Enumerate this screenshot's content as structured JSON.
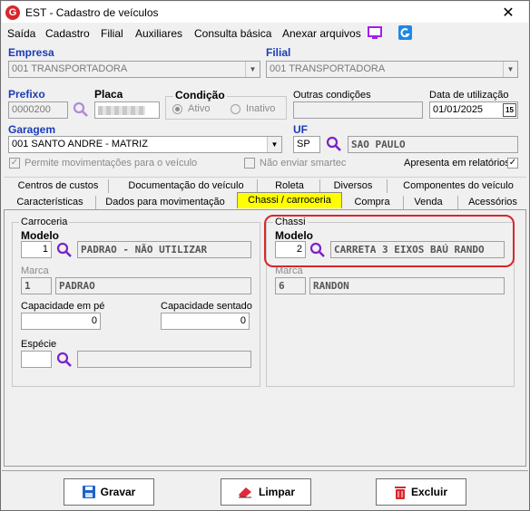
{
  "window": {
    "title": "EST - Cadastro de veículos",
    "close": "✕"
  },
  "menu": [
    "Saída",
    "Cadastro",
    "Filial",
    "Auxiliares",
    "Consulta básica",
    "Anexar arquivos"
  ],
  "header": {
    "empresa_label": "Empresa",
    "empresa_value": "001 TRANSPORTADORA",
    "filial_label": "Filial",
    "filial_value": "001 TRANSPORTADORA",
    "prefixo_label": "Prefixo",
    "prefixo_value": "0000200",
    "placa_label": "Placa",
    "condicao_label": "Condição",
    "ativo_label": "Ativo",
    "inativo_label": "Inativo",
    "outras_label": "Outras condições",
    "data_label": "Data de utilização",
    "data_value": "01/01/2025",
    "cal_label": "15",
    "garagem_label": "Garagem",
    "garagem_value": "001 SANTO ANDRE - MATRIZ",
    "uf_label": "UF",
    "uf_value": "SP",
    "uf_name": "SAO PAULO",
    "permite_label": "Permite movimentações para o veículo",
    "smartec_label": "Não enviar smartec",
    "relatorios_label": "Apresenta em relatórios",
    "check_mark": "✓"
  },
  "tabs_row1": [
    "Centros de custos",
    "Documentação do veículo",
    "Roleta",
    "Diversos",
    "Componentes do veículo"
  ],
  "tabs_row2": [
    "Características",
    "Dados para movimentação",
    "Chassi / carroceria",
    "Compra",
    "Venda",
    "Acessórios"
  ],
  "carroceria": {
    "group_title": "Carroceria",
    "modelo_label": "Modelo",
    "modelo_code": "1",
    "modelo_name": "PADRAO - NÃO UTILIZAR",
    "marca_label": "Marca",
    "marca_code": "1",
    "marca_name": "PADRAO",
    "cap_pe_label": "Capacidade em pé",
    "cap_pe_value": "0",
    "cap_sentado_label": "Capacidade sentado",
    "cap_sentado_value": "0",
    "especie_label": "Espécie"
  },
  "chassi": {
    "group_title": "Chassi",
    "modelo_label": "Modelo",
    "modelo_code": "2",
    "modelo_name": "CARRETA 3 EIXOS BAÚ RANDO",
    "marca_label": "Marca",
    "marca_code": "6",
    "marca_name": "RANDON"
  },
  "buttons": {
    "gravar": "Gravar",
    "limpar": "Limpar",
    "excluir": "Excluir"
  },
  "colors": {
    "accent_blue": "#1b3cb8",
    "active_tab": "#ffff00",
    "highlight_red": "#d9262b",
    "search_purple": "#7a22c8"
  }
}
